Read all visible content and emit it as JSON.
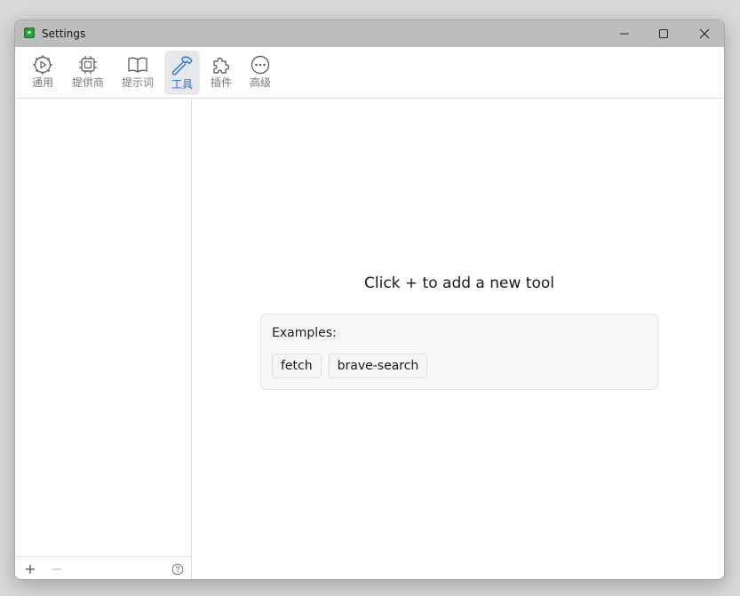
{
  "window": {
    "title": "Settings",
    "controls": {
      "minimize": "minimize-icon",
      "maximize": "maximize-icon",
      "close": "close-icon"
    }
  },
  "toolbar": {
    "tabs": [
      {
        "label": "通用",
        "icon": "gear-play-icon"
      },
      {
        "label": "提供商",
        "icon": "cpu-chip-icon"
      },
      {
        "label": "提示词",
        "icon": "open-book-icon"
      },
      {
        "label": "工具",
        "icon": "hammer-icon",
        "active": true
      },
      {
        "label": "插件",
        "icon": "puzzle-icon"
      },
      {
        "label": "高级",
        "icon": "more-dots-icon"
      }
    ]
  },
  "sidebar": {
    "footer": {
      "add_label": "+",
      "remove_label": "−",
      "help_icon": "question-icon"
    }
  },
  "main": {
    "empty_message": "Click + to add a new tool",
    "examples_label": "Examples:",
    "examples": [
      "fetch",
      "brave-search"
    ]
  },
  "colors": {
    "accent": "#2f6fd6",
    "titlebar": "#bdbdbd",
    "active_tab_bg": "#e6e8ec"
  }
}
